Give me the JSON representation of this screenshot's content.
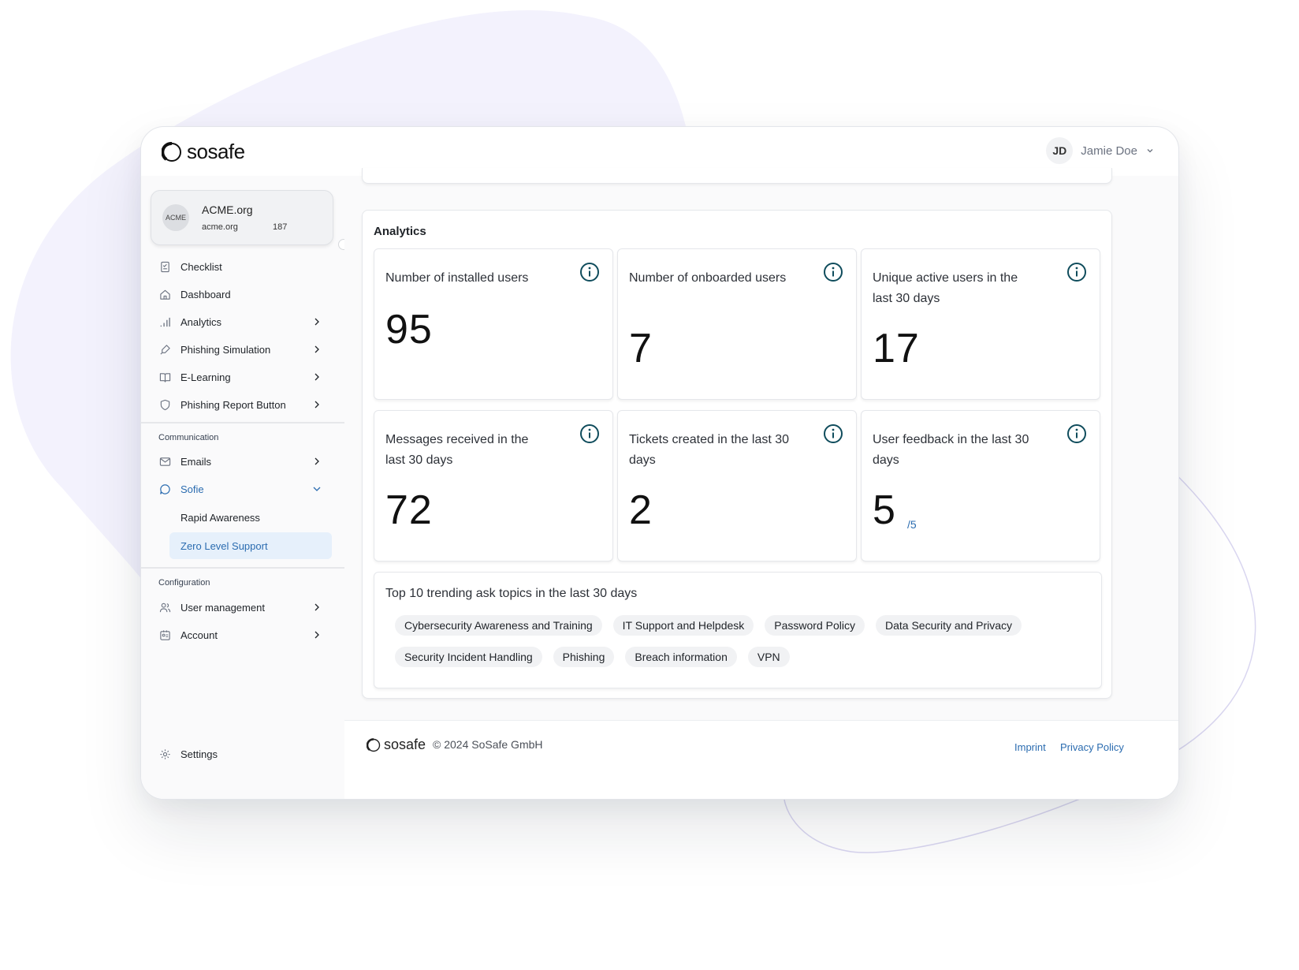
{
  "brand": {
    "name": "sosafe"
  },
  "user": {
    "initials": "JD",
    "name": "Jamie Doe"
  },
  "org": {
    "logo_text": "ACME",
    "name": "ACME.org",
    "domain": "acme.org",
    "count": "187"
  },
  "nav": {
    "items": [
      {
        "label": "Checklist",
        "icon": "checklist-icon"
      },
      {
        "label": "Dashboard",
        "icon": "home-icon"
      },
      {
        "label": "Analytics",
        "icon": "bar-chart-icon"
      },
      {
        "label": "Phishing Simulation",
        "icon": "hook-icon"
      },
      {
        "label": "E-Learning",
        "icon": "book-icon"
      },
      {
        "label": "Phishing Report Button",
        "icon": "shield-icon"
      }
    ],
    "communication": {
      "label": "Communication",
      "items": [
        {
          "label": "Emails",
          "icon": "mail-icon"
        },
        {
          "label": "Sofie",
          "icon": "chat-icon"
        }
      ],
      "sofie_sub": [
        {
          "label": "Rapid Awareness"
        },
        {
          "label": "Zero Level Support"
        }
      ]
    },
    "configuration": {
      "label": "Configuration",
      "items": [
        {
          "label": "User management",
          "icon": "users-icon"
        },
        {
          "label": "Account",
          "icon": "id-card-icon"
        }
      ]
    },
    "settings": {
      "label": "Settings",
      "icon": "gear-icon"
    }
  },
  "analytics": {
    "title": "Analytics",
    "cards": [
      {
        "label": "Number of installed users",
        "value": "95"
      },
      {
        "label": "Number of onboarded users",
        "value": "7"
      },
      {
        "label": "Unique active users in the last 30 days",
        "value": "17"
      },
      {
        "label": "Messages received in the last 30 days",
        "value": "72"
      },
      {
        "label": "Tickets created in the last 30 days",
        "value": "2"
      },
      {
        "label": "User feedback in the last 30 days",
        "value": "5",
        "suffix": "/5"
      }
    ],
    "topics": {
      "title": "Top 10 trending ask topics in the last 30 days",
      "chips": [
        "Cybersecurity Awareness and Training",
        "IT Support and Helpdesk",
        "Password Policy",
        "Data Security and Privacy",
        "Security Incident Handling",
        "Phishing",
        "Breach information",
        "VPN"
      ]
    }
  },
  "footer": {
    "logo_text": "sosafe",
    "copyright": "© 2024 SoSafe GmbH",
    "links": {
      "imprint": "Imprint",
      "privacy": "Privacy Policy"
    }
  },
  "colors": {
    "accent": "#2b6cb0",
    "info_icon": "#0f4c5c",
    "selected_bg": "#e6f0fb",
    "blob": "#f3f2fd"
  }
}
